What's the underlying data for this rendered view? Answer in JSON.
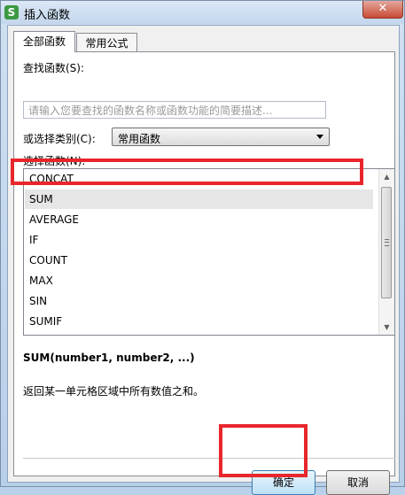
{
  "window": {
    "title": "插入函数",
    "app_icon_letter": "S",
    "close_symbol": "✕"
  },
  "tabs": [
    {
      "label": "全部函数"
    },
    {
      "label": "常用公式"
    }
  ],
  "search": {
    "label": "查找函数(S):",
    "placeholder": "请输入您要查找的函数名称或函数功能的简要描述..."
  },
  "category": {
    "label": "或选择类别(C):",
    "value": "常用函数"
  },
  "functions": {
    "label": "选择函数(N):",
    "items": [
      "CONCAT",
      "SUM",
      "AVERAGE",
      "IF",
      "COUNT",
      "MAX",
      "SIN",
      "SUMIF"
    ],
    "selected": "SUM"
  },
  "details": {
    "signature": "SUM(number1, number2, ...)",
    "description": "返回某一单元格区域中所有数值之和。"
  },
  "buttons": {
    "ok": "确定",
    "cancel": "取消"
  },
  "colors": {
    "highlight": "#e8262b",
    "titlebar": "#c3d6ec"
  }
}
